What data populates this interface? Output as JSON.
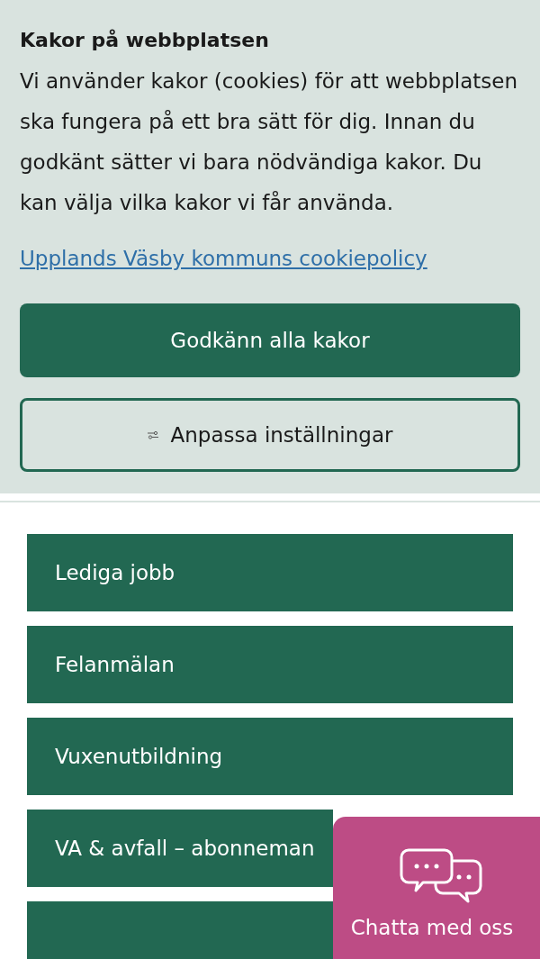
{
  "cookie_banner": {
    "title": "Kakor på webbplatsen",
    "text": "Vi använder kakor (cookies) för att webbplatsen ska fungera på ett bra sätt för dig. Innan du godkänt sätter vi bara nödvändiga kakor. Du kan välja vilka kakor vi får använda.",
    "policy_link": "Upplands Väsby kommuns cookiepolicy",
    "buttons": [
      {
        "label": "Godkänn alla kakor",
        "kind": "primary"
      },
      {
        "label": "Anpassa inställningar",
        "kind": "settings"
      }
    ]
  },
  "quick_links": [
    {
      "label": "Lediga jobb"
    },
    {
      "label": "Felanmälan"
    },
    {
      "label": "Vuxenutbildning"
    },
    {
      "label": "VA & avfall – abonneman"
    }
  ],
  "chat_widget": {
    "label": "Chatta med oss"
  }
}
